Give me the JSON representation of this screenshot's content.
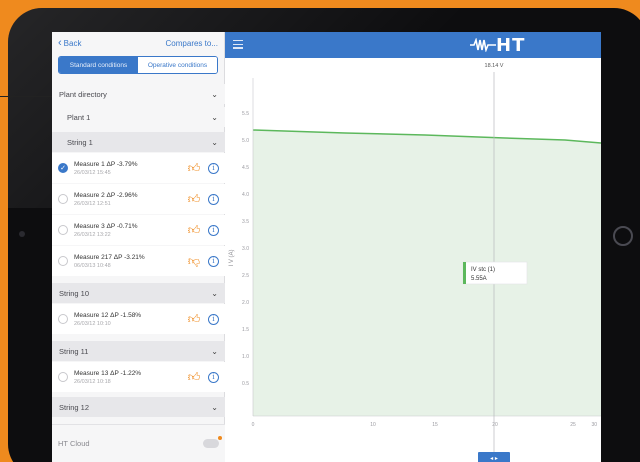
{
  "sidebar": {
    "back_label": "Back",
    "compare_label": "Compares to...",
    "segments": {
      "left": "Standard conditions",
      "right": "Operative conditions"
    },
    "plant_directory": "Plant directory",
    "plant": "Plant 1",
    "string1": "String 1",
    "measures": [
      {
        "title": "Measure 1  ΔP -3.79%",
        "date": "26/03/12 15:45",
        "selected": true,
        "thumb": "up"
      },
      {
        "title": "Measure 2  ΔP -2.96%",
        "date": "26/03/12 12:51",
        "selected": false,
        "thumb": "up"
      },
      {
        "title": "Measure 3  ΔP -0.71%",
        "date": "26/03/12 13:22",
        "selected": false,
        "thumb": "up"
      },
      {
        "title": "Measure 217  ΔP -3.21%",
        "date": "06/03/13 10:48",
        "selected": false,
        "thumb": "down"
      },
      {
        "title": "Measure 12  ΔP -1.58%",
        "date": "26/03/12 10:10",
        "selected": false,
        "thumb": "up"
      },
      {
        "title": "Measure 13  ΔP -1.22%",
        "date": "26/03/12 10:18",
        "selected": false,
        "thumb": "up"
      }
    ],
    "string10": "String 10",
    "string11": "String 11",
    "string12": "String 12",
    "footer": "HT Cloud"
  },
  "header": {
    "logo": "HT"
  },
  "plot": {
    "cursor_label": "18.14 V",
    "tooltip_line1": "IV stc (1)",
    "tooltip_line2": "5.55A",
    "ylabel": "I V (A)",
    "nav_label": "◂ ▸",
    "y_ticks": [
      "5.5",
      "5.0",
      "4.5",
      "4.0",
      "3.5",
      "3.0",
      "2.5",
      "2.0",
      "1.5",
      "1.0",
      "0.5"
    ],
    "x_ticks": [
      "0",
      "10",
      "15",
      "20",
      "25",
      "30"
    ]
  },
  "colors": {
    "accent": "#3a78c9",
    "curve": "#5cb85c",
    "fill": "#e7f2e7",
    "orange": "#ef8a1e"
  }
}
